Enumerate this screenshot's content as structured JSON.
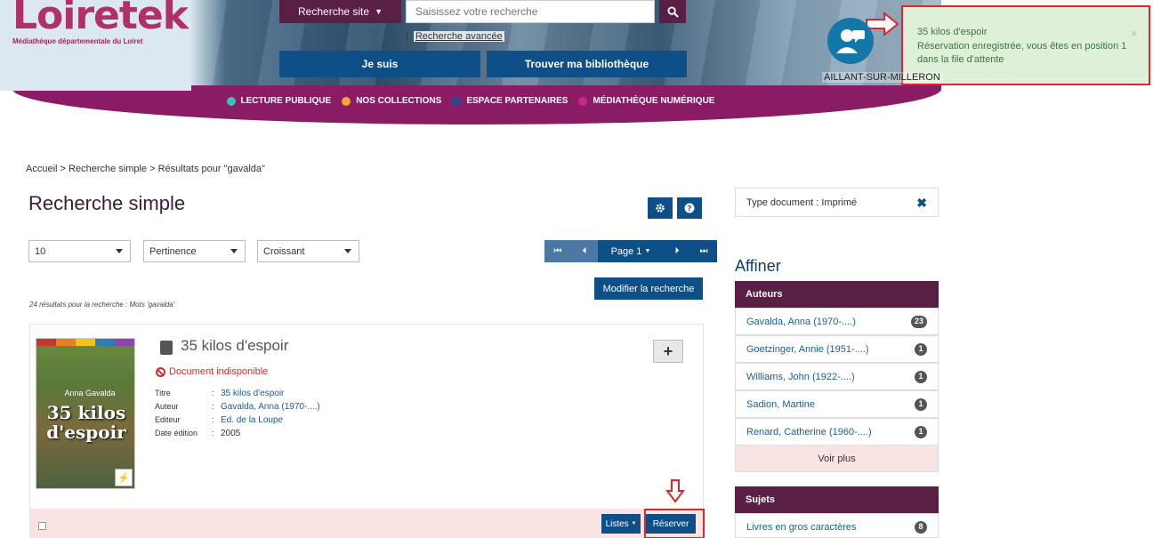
{
  "header": {
    "logo_text": "Loiretek",
    "logo_subtitle": "Médiathèque départementale du Loiret",
    "search_category": "Recherche site",
    "search_placeholder": "Saisissez votre recherche",
    "advanced_search": "Recherche avancée",
    "btn_je_suis": "Je suis",
    "btn_trouver": "Trouver ma bibliothèque",
    "location": "AILLANT-SUR-MILLERON"
  },
  "nav": [
    {
      "label": "LECTURE PUBLIQUE",
      "color": "#3dbfc4"
    },
    {
      "label": "NOS COLLECTIONS",
      "color": "#f4a535"
    },
    {
      "label": "ESPACE PARTENAIRES",
      "color": "#1e4f8a"
    },
    {
      "label": "MÉDIATHÈQUE NUMÉRIQUE",
      "color": "#c8268e"
    }
  ],
  "toast": {
    "title": "35 kilos d'espoir",
    "message": "Réservation enregistrée, vous êtes en position 1 dans la file d'attente",
    "close": "×"
  },
  "breadcrumb": {
    "home": "Accueil",
    "sep": " > ",
    "simple": "Recherche simple",
    "results": "Résultats pour \"gavalda\""
  },
  "page_title": "Recherche simple",
  "controls": {
    "per_page": "10",
    "sort_by": "Pertinence",
    "order": "Croissant",
    "page_label": "Page 1",
    "modify_search": "Modifier la recherche",
    "result_count": "24 résultats pour la recherche : Mots 'gavalda'"
  },
  "result": {
    "cover_author": "Anna Gavalda",
    "cover_title": "35 kilos d'espoir",
    "title": "35 kilos d'espoir",
    "status": "Document indisponible",
    "fields": [
      {
        "label": "Titre",
        "value": "35 kilos d'espoir",
        "link": true
      },
      {
        "label": "Auteur",
        "value": "Gavalda, Anna (1970-....)",
        "link": true
      },
      {
        "label": "Editeur",
        "value": "Ed. de la Loupe",
        "link": true
      },
      {
        "label": "Date édition",
        "value": "2005",
        "link": false
      }
    ],
    "btn_listes": "Listes",
    "btn_reserver": "Réserver"
  },
  "sidebar": {
    "active_filter": "Type document  :  Imprimé",
    "affiner": "Affiner",
    "authors_title": "Auteurs",
    "authors": [
      {
        "name": "Gavalda, Anna (1970-....)",
        "count": "23"
      },
      {
        "name": "Goetzinger, Annie (1951-....)",
        "count": "1"
      },
      {
        "name": "Williams, John (1922-....)",
        "count": "1"
      },
      {
        "name": "Sadion, Martine",
        "count": "1"
      },
      {
        "name": "Renard, Catherine (1960-....)",
        "count": "1"
      }
    ],
    "see_more": "Voir plus",
    "subjects_title": "Sujets",
    "subjects": [
      {
        "name": "Livres en gros caractères",
        "count": "8"
      }
    ]
  },
  "colors": {
    "brand_purple": "#5a1f45",
    "nav_magenta": "#8a1c65",
    "primary_blue": "#0e4f87",
    "toast_green": "#dff0d8",
    "highlight_red": "#e0262c"
  }
}
